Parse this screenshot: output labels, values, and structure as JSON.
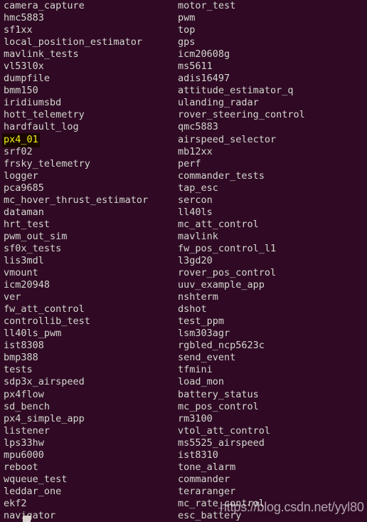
{
  "terminal": {
    "background_color": "#300a24",
    "text_color": "#d3d7cf",
    "selection_background": "#190700",
    "selection_color": "#f3f315",
    "cursor_color": "#d8d0cc",
    "selected_entry": "px4_01",
    "left_column": [
      "camera_capture",
      "hmc5883",
      "sf1xx",
      "local_position_estimator",
      "mavlink_tests",
      "vl53l0x",
      "dumpfile",
      "bmm150",
      "iridiumsbd",
      "hott_telemetry",
      "hardfault_log",
      "px4_01",
      "srf02",
      "frsky_telemetry",
      "logger",
      "pca9685",
      "mc_hover_thrust_estimator",
      "dataman",
      "hrt_test",
      "pwm_out_sim",
      "sf0x_tests",
      "lis3mdl",
      "vmount",
      "icm20948",
      "ver",
      "fw_att_control",
      "controllib_test",
      "ll40ls_pwm",
      "ist8308",
      "bmp388",
      "tests",
      "sdp3x_airspeed",
      "px4flow",
      "sd_bench",
      "px4_simple_app",
      "listener",
      "lps33hw",
      "mpu6000",
      "reboot",
      "wqueue_test",
      "leddar_one",
      "ekf2",
      "navigator"
    ],
    "right_column": [
      "motor_test",
      "pwm",
      "top",
      "gps",
      "icm20608g",
      "ms5611",
      "adis16497",
      "attitude_estimator_q",
      "ulanding_radar",
      "rover_steering_control",
      "qmc5883",
      "airspeed_selector",
      "mb12xx",
      "perf",
      "commander_tests",
      "tap_esc",
      "sercon",
      "ll40ls",
      "mc_att_control",
      "mavlink",
      "fw_pos_control_l1",
      "l3gd20",
      "rover_pos_control",
      "uuv_example_app",
      "nshterm",
      "dshot",
      "test_ppm",
      "lsm303agr",
      "rgbled_ncp5623c",
      "send_event",
      "tfmini",
      "load_mon",
      "battery_status",
      "mc_pos_control",
      "rm3100",
      "vtol_att_control",
      "ms5525_airspeed",
      "ist8310",
      "tone_alarm",
      "commander",
      "teraranger",
      "mc_rate_control",
      "esc_battery"
    ]
  },
  "watermark": {
    "text": "https://blog.csdn.net/yyl80"
  }
}
